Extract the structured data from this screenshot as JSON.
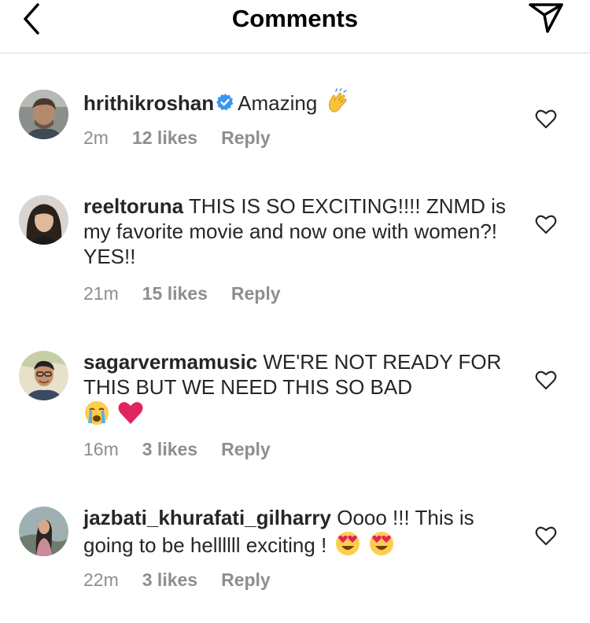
{
  "header": {
    "title": "Comments",
    "back_icon": "chevron-left-icon",
    "send_icon": "paper-plane-icon"
  },
  "colors": {
    "verified": "#3897f0",
    "muted": "#8e8e8e",
    "text": "#262626",
    "divider": "#dbdbdb"
  },
  "comments": [
    {
      "username": "hrithikroshan",
      "verified": true,
      "text": "Amazing",
      "emojis": [
        "clapping-hands-emoji"
      ],
      "time": "2m",
      "likes": "12 likes",
      "reply": "Reply"
    },
    {
      "username": "reeltoruna",
      "verified": false,
      "text": "THIS IS SO EXCITING!!!! ZNMD is my favorite movie and now one with women?! YES!!",
      "emojis": [],
      "time": "21m",
      "likes": "15 likes",
      "reply": "Reply"
    },
    {
      "username": "sagarvermamusic",
      "verified": false,
      "text": "WE'RE NOT READY FOR THIS BUT WE NEED THIS SO BAD",
      "emojis": [
        "loudly-crying-face-emoji",
        "red-heart-emoji"
      ],
      "time": "16m",
      "likes": "3 likes",
      "reply": "Reply"
    },
    {
      "username": "jazbati_khurafati_gilharry",
      "verified": false,
      "text": "Oooo !!! This is going to be hellllll exciting !",
      "emojis": [
        "heart-eyes-emoji",
        "heart-eyes-emoji"
      ],
      "time": "22m",
      "likes": "3 likes",
      "reply": "Reply"
    }
  ]
}
